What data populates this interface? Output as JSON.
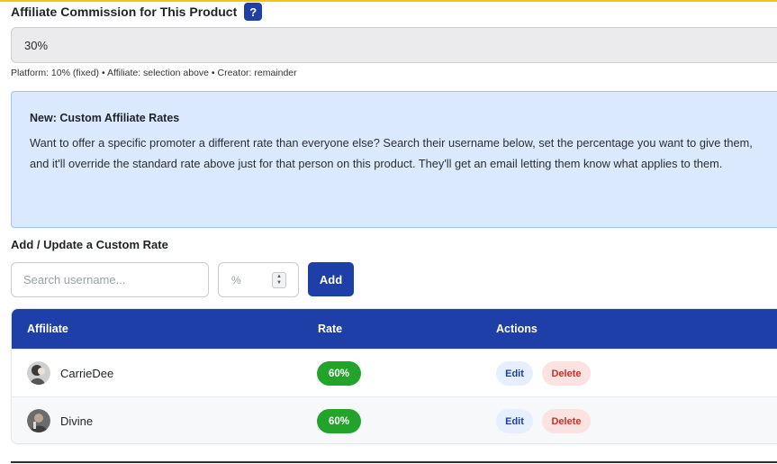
{
  "commission": {
    "label": "Affiliate Commission for This Product",
    "help_label": "?",
    "selected_value": "30%",
    "split_note": "Platform: 10% (fixed) • Affiliate: selection above • Creator: remainder"
  },
  "info": {
    "title": "New: Custom Affiliate Rates",
    "body": "Want to offer a specific promoter a different rate than everyone else? Search their username below, set the percentage you want to give them, and it'll override the standard rate above just for that person on this product. They'll get an email letting them know what applies to them."
  },
  "custom_rate": {
    "heading": "Add / Update a Custom Rate",
    "search_placeholder": "Search username...",
    "rate_placeholder": "%",
    "add_label": "Add"
  },
  "table": {
    "headers": {
      "affiliate": "Affiliate",
      "rate": "Rate",
      "actions": "Actions"
    },
    "rows": [
      {
        "username": "CarrieDee",
        "rate": "60%",
        "edit_label": "Edit",
        "delete_label": "Delete"
      },
      {
        "username": "Divine",
        "rate": "60%",
        "edit_label": "Edit",
        "delete_label": "Delete"
      }
    ]
  },
  "colors": {
    "primary": "#1e3ea8",
    "rate_badge": "#22a42a",
    "info_bg": "#dbe9fe",
    "delete_text": "#c8302c"
  },
  "icons": {
    "help": "question-mark-icon",
    "stepper": "spin-stepper-icon",
    "avatar": "user-avatar-photo"
  }
}
